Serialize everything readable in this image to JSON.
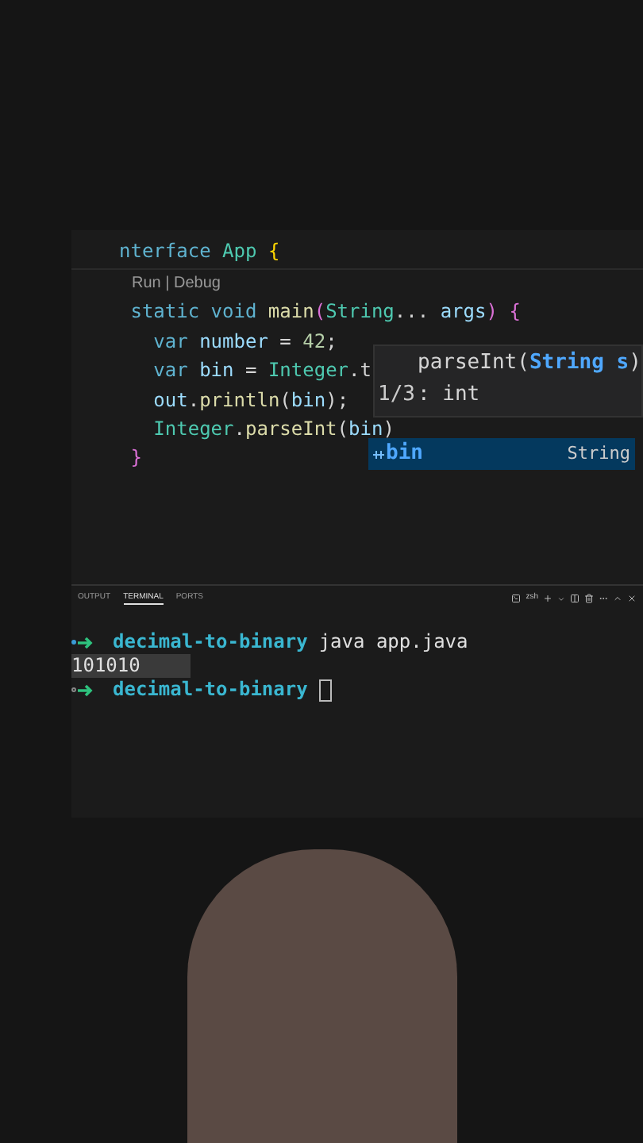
{
  "editor": {
    "lines": [
      {
        "kind": "sticky",
        "tokens": [
          {
            "kind": "keyword",
            "text": "nterface "
          },
          {
            "kind": "type",
            "text": "App "
          },
          {
            "kind": "brace",
            "text": "{"
          }
        ]
      },
      {
        "kind": "codelens",
        "text": "Run | Debug"
      },
      {
        "kind": "code",
        "tokens": [
          {
            "kind": "keyword",
            "text": " static "
          },
          {
            "kind": "keyword",
            "text": "void "
          },
          {
            "kind": "function",
            "text": "main"
          },
          {
            "kind": "brace2",
            "text": "("
          },
          {
            "kind": "type",
            "text": "String"
          },
          {
            "kind": "plain",
            "text": "... "
          },
          {
            "kind": "variable",
            "text": "args"
          },
          {
            "kind": "brace2",
            "text": ") "
          },
          {
            "kind": "brace2",
            "text": "{"
          }
        ]
      },
      {
        "kind": "code",
        "tokens": [
          {
            "kind": "keyword",
            "text": "   var "
          },
          {
            "kind": "variable",
            "text": "number"
          },
          {
            "kind": "plain",
            "text": " = "
          },
          {
            "kind": "number",
            "text": "42"
          },
          {
            "kind": "plain",
            "text": ";"
          }
        ]
      },
      {
        "kind": "code",
        "tokens": [
          {
            "kind": "keyword",
            "text": "   var "
          },
          {
            "kind": "variable",
            "text": "bin"
          },
          {
            "kind": "plain",
            "text": " = "
          },
          {
            "kind": "type",
            "text": "Integer"
          },
          {
            "kind": "plain",
            "text": ".t"
          }
        ]
      },
      {
        "kind": "code",
        "tokens": [
          {
            "kind": "variable",
            "text": "   out"
          },
          {
            "kind": "plain",
            "text": "."
          },
          {
            "kind": "function",
            "text": "println"
          },
          {
            "kind": "plain",
            "text": "("
          },
          {
            "kind": "variable",
            "text": "bin"
          },
          {
            "kind": "plain",
            "text": ");"
          }
        ]
      },
      {
        "kind": "code",
        "tokens": [
          {
            "kind": "type",
            "text": "   Integer"
          },
          {
            "kind": "plain",
            "text": "."
          },
          {
            "kind": "function",
            "text": "parseInt"
          },
          {
            "kind": "plain",
            "text": "("
          },
          {
            "kind": "variable",
            "text": "bin"
          },
          {
            "kind": "plain",
            "text": ")"
          }
        ]
      },
      {
        "kind": "code",
        "tokens": [
          {
            "kind": "brace2",
            "text": " }"
          }
        ]
      }
    ],
    "signature_help": {
      "signature": "parseInt(",
      "param": "String s",
      "close": ")",
      "counter": "1/3",
      "returns": ": int"
    },
    "suggestions": [
      {
        "label": "bin",
        "detail": "String",
        "selected": true
      }
    ]
  },
  "panel": {
    "tabs": [
      {
        "label": "OUTPUT",
        "selected": false
      },
      {
        "label": "TERMINAL",
        "selected": true
      },
      {
        "label": "PORTS",
        "selected": false
      }
    ],
    "shell": "zsh",
    "terminal": [
      {
        "kind": "prompt",
        "success": true,
        "dir": "decimal-to-binary",
        "command": "java app.java"
      },
      {
        "kind": "output",
        "text": "101010",
        "selected": true
      },
      {
        "kind": "prompt",
        "success": false,
        "dir": "decimal-to-binary"
      }
    ]
  }
}
